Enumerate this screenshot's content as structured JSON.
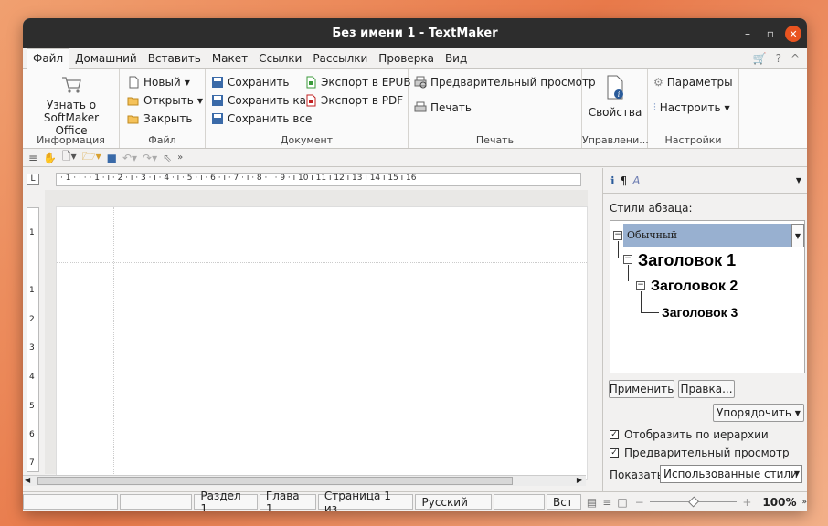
{
  "window": {
    "title": "Без имени 1 - TextMaker"
  },
  "menu_tabs": [
    "Файл",
    "Домашний",
    "Вставить",
    "Макет",
    "Ссылки",
    "Рассылки",
    "Проверка",
    "Вид"
  ],
  "ribbon": {
    "info": {
      "learn_label": "Узнать о\nSoftMaker Office",
      "group_label": "Информация"
    },
    "file": {
      "new_label": "Новый",
      "open_label": "Открыть",
      "close_label": "Закрыть",
      "group_label": "Файл"
    },
    "document": {
      "save_label": "Сохранить",
      "save_as_label": "Сохранить как",
      "save_all_label": "Сохранить все",
      "export_epub_label": "Экспорт в EPUB",
      "export_pdf_label": "Экспорт в PDF",
      "group_label": "Документ"
    },
    "print": {
      "preview_label": "Предварительный просмотр",
      "print_label": "Печать",
      "group_label": "Печать"
    },
    "manage": {
      "properties_label": "Свойства",
      "group_label": "Управлени..."
    },
    "settings": {
      "params_label": "Параметры",
      "customize_label": "Настроить",
      "group_label": "Настройки"
    }
  },
  "ruler": {
    "marks": "· 1 · ·  ·  · 1 · ı · 2 · ı · 3 · ı · 4 · ı · 5 · ı · 6 · ı · 7 · ı · 8 · ı · 9 · ı 10 ı 11 ı 12 ı 13 ı 14 ı 15 ı 16"
  },
  "vruler": [
    "1",
    "1",
    "2",
    "3",
    "4",
    "5",
    "6",
    "7"
  ],
  "panel": {
    "section_label": "Стили абзаца:",
    "selected_style": "Обычный",
    "heading1": "Заголовок 1",
    "heading2": "Заголовок 2",
    "heading3": "Заголовок 3",
    "apply_label": "Применить",
    "edit_label": "Правка...",
    "sort_label": "Упорядочить",
    "hierarchy_label": "Отобразить по иерархии",
    "preview_label": "Предварительный просмотр",
    "show_label": "Показать:",
    "show_value": "Использованные стили"
  },
  "status": {
    "section": "Раздел 1",
    "chapter": "Глава 1",
    "page": "Страница 1 из",
    "language": "Русский",
    "mode": "Вст",
    "zoom": "100%"
  }
}
